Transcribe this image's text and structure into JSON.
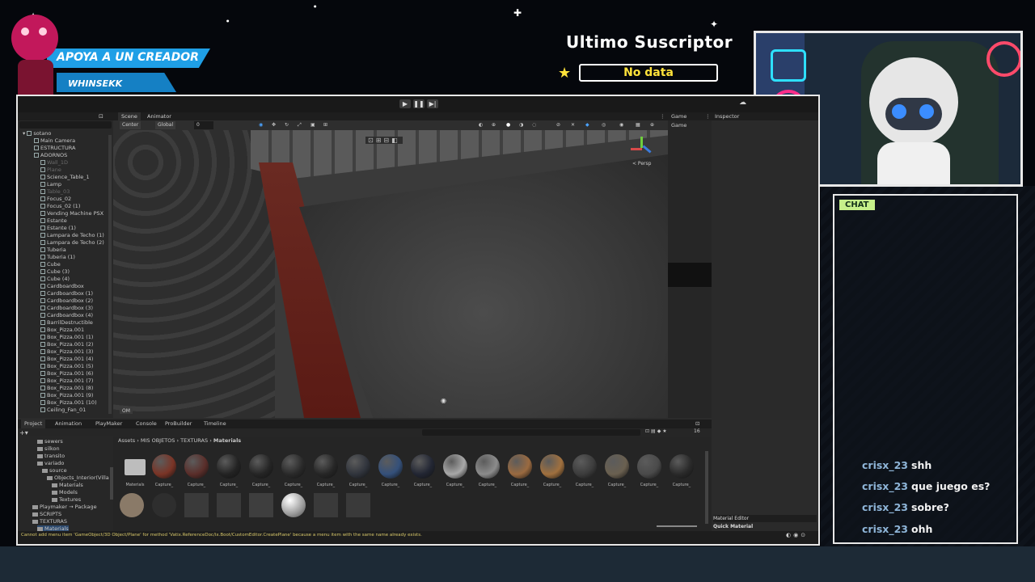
{
  "overlay": {
    "banner_title": "APOYA A UN CREADOR",
    "banner_name": "WHINSEKK",
    "last_sub_title": "Ultimo Suscriptor",
    "last_sub_value": "No data",
    "chat_label": "CHAT",
    "chat_messages": [
      {
        "user": "crisx_23",
        "text": "shh"
      },
      {
        "user": "crisx_23",
        "text": "que juego es?"
      },
      {
        "user": "crisx_23",
        "text": "sobre?"
      },
      {
        "user": "crisx_23",
        "text": "ohh"
      }
    ]
  },
  "unity": {
    "scene_tabs": [
      "Scene",
      "Animator"
    ],
    "game_tab": "Game",
    "game_sub": "Game",
    "inspector_tab": "Inspector",
    "pivot_mode": "Center",
    "space_mode": "Global",
    "snap_value": "0",
    "persp_label": "< Persp",
    "scene_badge": "OM",
    "hierarchy_root": "sotano",
    "hierarchy_items": [
      "Main Camera",
      "ESTRUCTURA",
      "ADORNOS",
      "Wall_1D",
      "Plane",
      "Science_Table_1",
      "Lamp",
      "Table_03",
      "Focus_02",
      "Focus_02 (1)",
      "Vending Machine PSX",
      "Estante",
      "Estante (1)",
      "Lampara de Techo (1)",
      "Lampara de Techo (2)",
      "Tuberia",
      "Tuberia (1)",
      "Cube",
      "Cube (3)",
      "Cube (4)",
      "Cardboardbox",
      "Cardboardbox (1)",
      "Cardboardbox (2)",
      "Cardboardbox (3)",
      "Cardboardbox (4)",
      "BarrilDestructible",
      "Box_Pizza.001",
      "Box_Pizza.001 (1)",
      "Box_Pizza.001 (2)",
      "Box_Pizza.001 (3)",
      "Box_Pizza.001 (4)",
      "Box_Pizza.001 (5)",
      "Box_Pizza.001 (6)",
      "Box_Pizza.001 (7)",
      "Box_Pizza.001 (8)",
      "Box_Pizza.001 (9)",
      "Box_Pizza.001 (10)",
      "Ceiling_Fan_01"
    ],
    "bottom_tabs": [
      "Project",
      "Animation",
      "PlayMaker",
      "Console",
      "ProBuilder",
      "Timeline"
    ],
    "breadcrumb": [
      "Assets",
      "MIS OBJETOS",
      "TEXTURAS",
      "Materials"
    ],
    "asset_count": "16",
    "folders": [
      {
        "name": "sewers",
        "indent": 0
      },
      {
        "name": "silkon",
        "indent": 0
      },
      {
        "name": "transito",
        "indent": 0
      },
      {
        "name": "variado",
        "indent": 0
      },
      {
        "name": "source",
        "indent": 1
      },
      {
        "name": "Objects_Interior(Villa",
        "indent": 2
      },
      {
        "name": "Materials",
        "indent": 3
      },
      {
        "name": "Models",
        "indent": 3
      },
      {
        "name": "Textures",
        "indent": 3
      },
      {
        "name": "Playmaker → Package",
        "indent": -1
      },
      {
        "name": "SCRIPTS",
        "indent": -1
      },
      {
        "name": "TEXTURAS",
        "indent": -1
      },
      {
        "name": "Materials",
        "indent": 0
      }
    ],
    "first_asset": "Materials",
    "material_label": "Capture_",
    "material_editor": "Material Editor",
    "quick_material": "Quick Material",
    "status_text": "Cannot add menu item 'GameObject/3D Object/Plane' for method 'Vatix.ReferenceDoc/ix.Boot/CustomEditor.CreatePlane' because a menu item with the same name already exists."
  },
  "colors": {
    "banner_light": "#1f9fe6",
    "banner_dark": "#1580c4",
    "sub_value": "#ffe23a",
    "chat_label_bg": "#c6f08a",
    "chat_user": "#8fb6d9"
  }
}
